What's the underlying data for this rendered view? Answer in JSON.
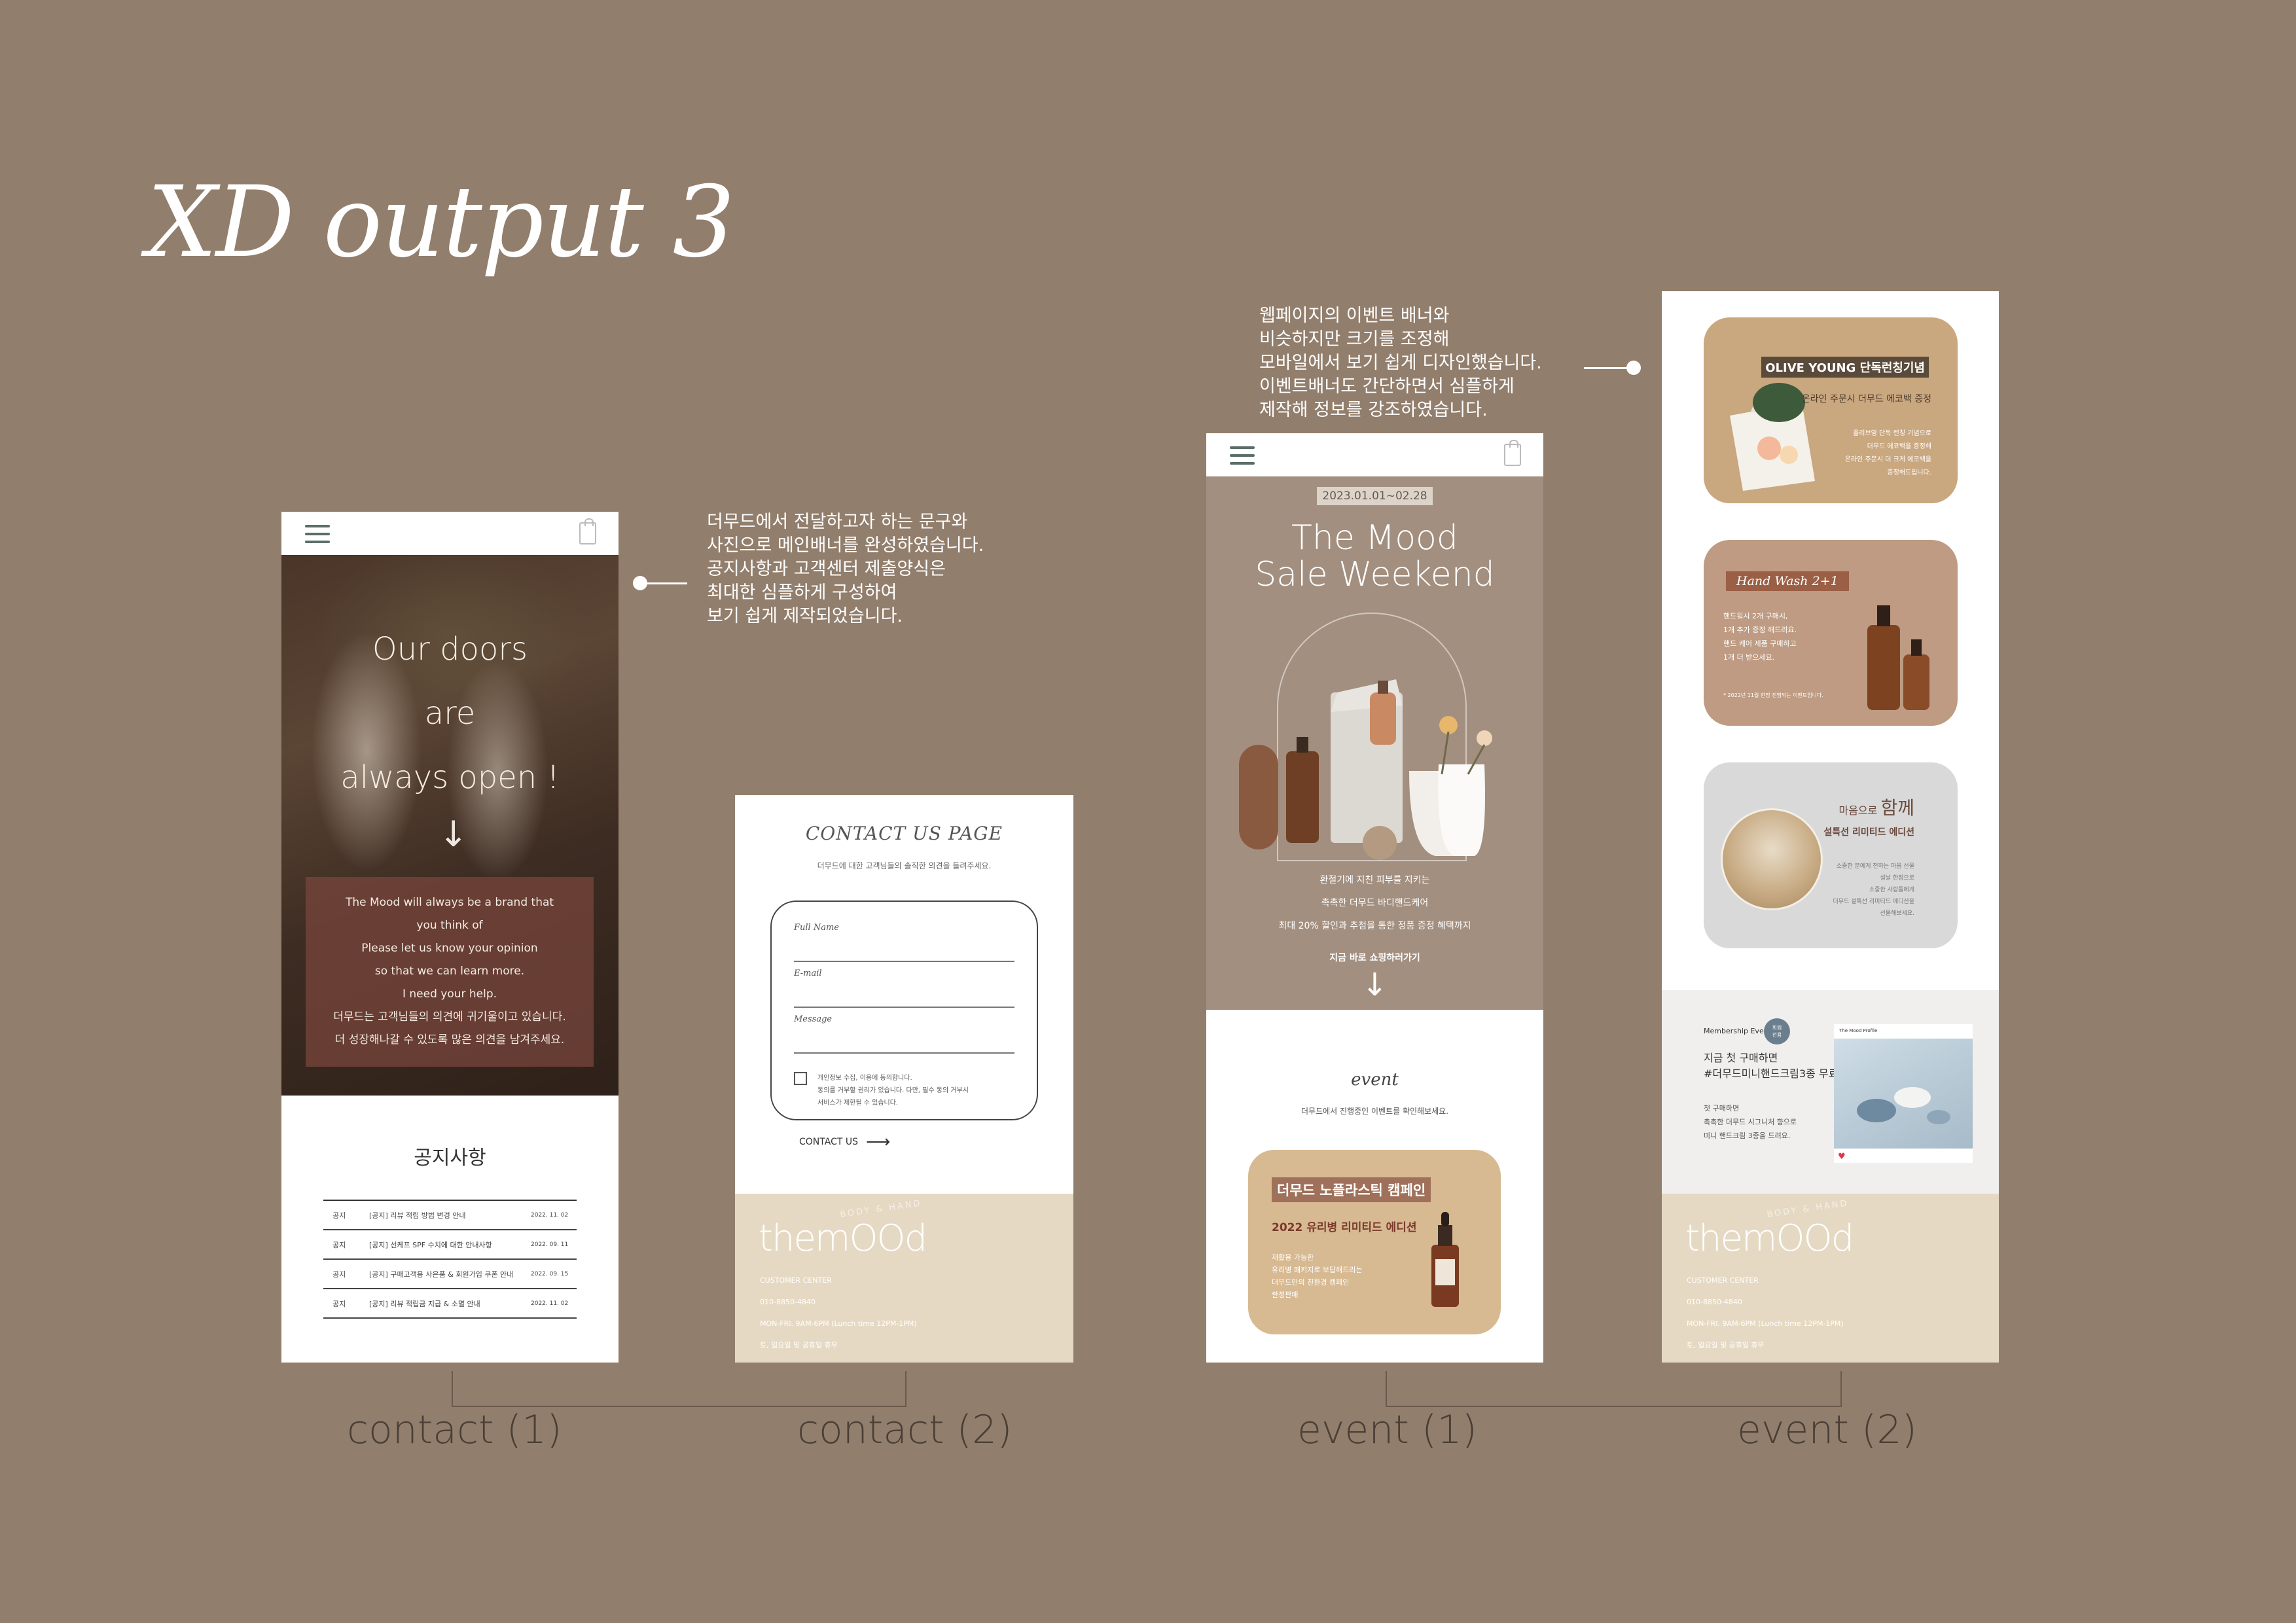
{
  "title": "XD output 3",
  "annotations": {
    "contact": "더무드에서  전달하고자 하는 문구와\n사진으로 메인배너를 완성하였습니다.\n공지사항과 고객센터 제출양식은\n최대한 심플하게 구성하여\n보기 쉽게 제작되었습니다.",
    "event": "웹페이지의 이벤트 배너와\n비슷하지만 크기를 조정해\n모바일에서 보기 쉽게 디자인했습니다.\n이벤트배너도 간단하면서 심플하게\n제작해 정보를 강조하였습니다."
  },
  "captions": {
    "contact1": "contact (1)",
    "contact2": "contact (2)",
    "event1": "event (1)",
    "event2": "event (2)"
  },
  "contact1": {
    "hero_title": "Our doors\nare\nalways open !",
    "arrow": "↓",
    "box_text": "The Mood will always be a brand that\nyou think of\nPlease let us know your opinion\nso that we can learn more.\nI need your help.\n더무드는 고객님들의 의견에 귀기울이고 있습니다.\n더 성장해나갈 수 있도록 많은 의견을 남겨주세요.",
    "notice_title": "공지사항",
    "notices": [
      {
        "tag": "공지",
        "text": "[공지] 리뷰 적립 방법 변경 안내",
        "date": "2022. 11. 02"
      },
      {
        "tag": "공지",
        "text": "[공지] 선케프 SPF 수치에 대한 안내사항",
        "date": "2022. 09. 11"
      },
      {
        "tag": "공지",
        "text": "[공지] 구매고객용 사은품 & 회원가입 쿠폰 안내",
        "date": "2022. 09. 15"
      },
      {
        "tag": "공지",
        "text": "[공지] 리뷰 적립금 지급 & 소멸 안내",
        "date": "2022. 11. 02"
      }
    ]
  },
  "contact2": {
    "page_title": "CONTACT US PAGE",
    "subtitle": "더무드에 대한 고객님들의 솔직한 의견을 들려주세요.",
    "fields": [
      "Full Name",
      "E-mail",
      "Message"
    ],
    "consent": "개인정보 수집, 이용에 동의합니다.\n동의를 거부할 권리가 있습니다. 다만, 필수 동의 거부시\n서비스가 제한될 수 있습니다.",
    "submit": "CONTACT US",
    "submit_arrow": "⟶"
  },
  "footer": {
    "arc": "BODY & HAND",
    "logo": "themOOd",
    "info": "CUSTOMER CENTER\n010-8850-4840\nMON-FRI. 9AM-6PM  (Lunch time 12PM-1PM)\n토, 일요일 및 공휴일 휴무"
  },
  "event1": {
    "date": "2023.01.01~02.28",
    "title": "The Mood\nSale Weekend",
    "lines": "환절기에 지친 피부를 지키는\n촉촉한 더무드 바디핸드케어\n최대 20% 할인과 추첨을 통한 정품 증정 혜택까지",
    "cta": "지금 바로 쇼핑하러가기",
    "arrow": "↓",
    "section_script": "event",
    "section_sub": "더무드에서 진행중인 이벤트를 확인해보세요.",
    "card_tag": "더무드 노플라스틱 캠페인",
    "card_sub": "2022 유리병 리미티드 에디션",
    "card_body": "재활용 가능한\n유리병 패키지로 보답해드리는\n더무드만의 친환경 캠페인\n한정판매"
  },
  "event2": {
    "oy_tag": "OLIVE YOUNG 단독런칭기념",
    "oy_sub": "온라인 주문시 더무드 에코백 증정",
    "oy_body": "올리브영 단독 런칭 기념으로\n더무드 에코백을 증정해\n온라인 주문시 더 크게 에코백을\n증정해드립니다.",
    "hw_tag": "Hand Wash 2+1",
    "hw_body": "핸드워시 2개 구매시,\n1개 추가 증정 해드려요.\n핸드 케어 제품 구매하고\n1개 더 받으세요.",
    "hw_foot": "* 2022년 11월 한정 진행되는 이벤트입니다.",
    "mh_title_small": "마음으로",
    "mh_title_big": "함께",
    "mh_sub": "설특선 리미티드 에디션",
    "mh_body": "소중한 분에게 전하는 마음 선물\n설날 한정으로\n소중한 사람들에게\n더무드 설특선 리미티드 에디션을\n선물해보세요.",
    "mem_label": "Membership Event",
    "mem_badge": "회원\n전용",
    "mem_title": "지금 첫 구매하면\n#더무드미니핸드크림3종 무료",
    "mem_body": "첫 구매하면\n촉촉한 더무드 시그니처 향으로\n미니 핸드크림 3종을 드려요.",
    "insta_user": "The Mood Profile"
  },
  "colors": {
    "background": "#927e6c",
    "footer": "#e6d9c3",
    "event_hero": "#a38f7f",
    "card_tan": "#d7b992"
  }
}
